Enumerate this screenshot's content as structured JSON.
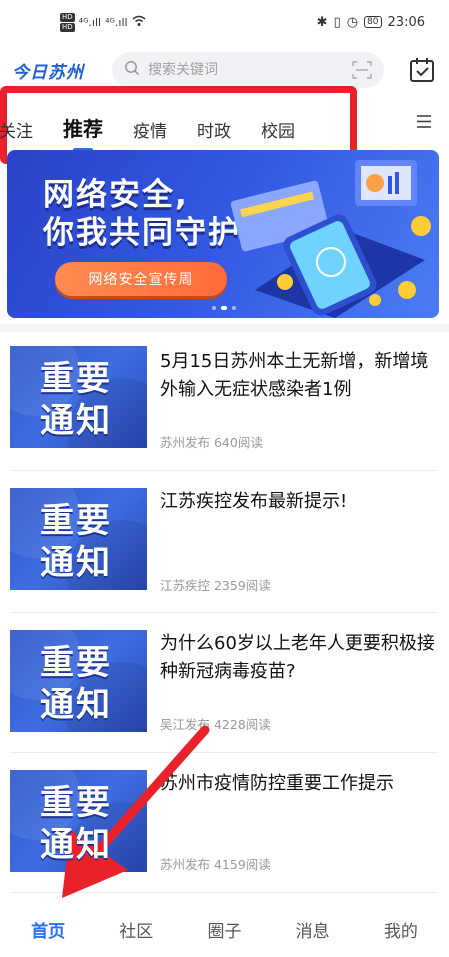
{
  "status_bar": {
    "hd1": "HD",
    "hd2": "HD",
    "signal1": "⁴ᴳ.ıll",
    "signal2": "⁴ᴳ.ıll",
    "battery": "80",
    "time": "23:06"
  },
  "header": {
    "logo": "今日苏州",
    "search_placeholder": "搜索关键词"
  },
  "tabs": [
    {
      "label": "关注"
    },
    {
      "label": "推荐"
    },
    {
      "label": "疫情"
    },
    {
      "label": "时政"
    },
    {
      "label": "校园"
    }
  ],
  "banner": {
    "title_line1": "网络安全,",
    "title_line2": "你我共同守护",
    "button": "网络安全宣传周"
  },
  "news": [
    {
      "thumb_line1": "重要",
      "thumb_line2": "通知",
      "title": "5月15日苏州本土无新增，新增境外输入无症状感染者1例",
      "meta": "苏州发布 640阅读"
    },
    {
      "thumb_line1": "重要",
      "thumb_line2": "通知",
      "title": "江苏疾控发布最新提示!",
      "meta": "江苏疾控 2359阅读"
    },
    {
      "thumb_line1": "重要",
      "thumb_line2": "通知",
      "title": "为什么60岁以上老年人更要积极接种新冠病毒疫苗?",
      "meta": "吴江发布 4228阅读"
    },
    {
      "thumb_line1": "重要",
      "thumb_line2": "通知",
      "title": "苏州市疫情防控重要工作提示",
      "meta": "苏州发布 4159阅读"
    }
  ],
  "bottom_nav": [
    {
      "label": "首页"
    },
    {
      "label": "社区"
    },
    {
      "label": "圈子"
    },
    {
      "label": "消息"
    },
    {
      "label": "我的"
    }
  ],
  "colors": {
    "accent": "#2b6ef2",
    "highlight_box": "#e8212b",
    "banner_blue": "#3156e0"
  }
}
